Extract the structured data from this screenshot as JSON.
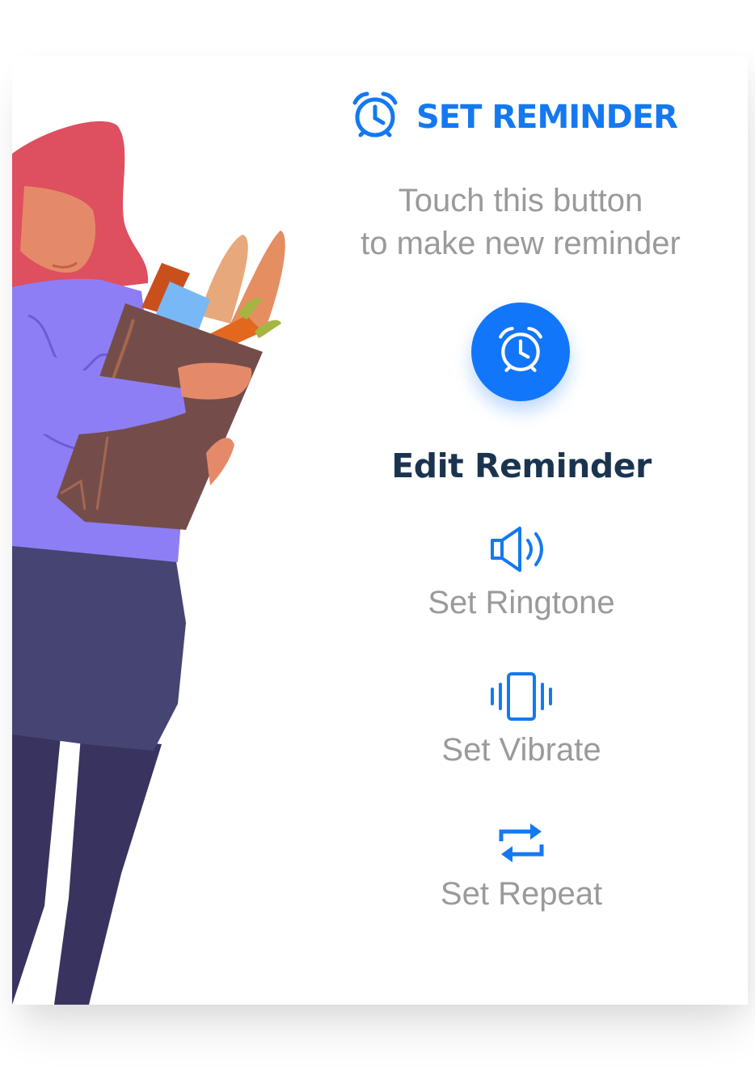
{
  "header": {
    "title": "SET REMINDER",
    "icon": "alarm-clock-icon"
  },
  "instructions": {
    "line1": "Touch this button",
    "line2": "to make new reminder"
  },
  "new_reminder_button": {
    "icon": "alarm-clock-icon"
  },
  "edit_section": {
    "title": "Edit Reminder",
    "options": [
      {
        "icon": "speaker-icon",
        "label": "Set Ringtone"
      },
      {
        "icon": "vibrate-icon",
        "label": "Set Vibrate"
      },
      {
        "icon": "repeat-icon",
        "label": "Set Repeat"
      }
    ]
  },
  "colors": {
    "accent": "#1479f1",
    "heading": "#1a3450",
    "muted_text": "#9a9a9a"
  }
}
